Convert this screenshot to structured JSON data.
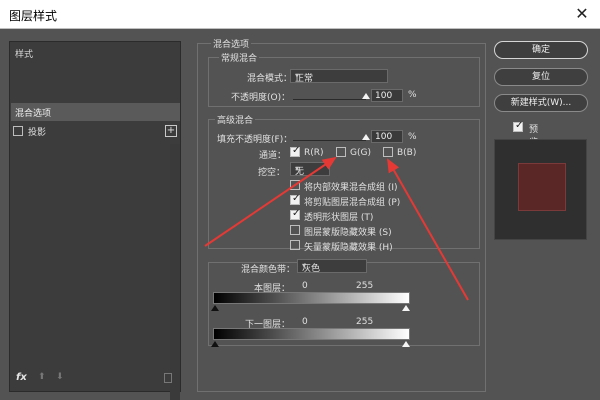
{
  "dialog": {
    "title": "图层样式",
    "close_symbol": "✕"
  },
  "left": {
    "header": "样式",
    "selected_item": "混合选项",
    "items": [
      {
        "label": "投影",
        "checked": false
      }
    ],
    "add_symbol": "+",
    "footer": {
      "fx": "fx",
      "up": "⬆",
      "down": "⬇"
    }
  },
  "blend": {
    "section_title": "混合选项",
    "general": {
      "title": "常规混合",
      "mode_label": "混合模式：",
      "mode_value": "正常",
      "opacity_label": "不透明度(O)：",
      "opacity_value": "100",
      "opacity_unit": "%",
      "opacity_level": 100
    },
    "advanced": {
      "title": "高级混合",
      "fill_label": "填充不透明度(F)：",
      "fill_value": "100",
      "fill_unit": "%",
      "fill_level": 100,
      "channels_label": "通道：",
      "channels": [
        {
          "label": "R(R)",
          "checked": true
        },
        {
          "label": "G(G)",
          "checked": false
        },
        {
          "label": "B(B)",
          "checked": false
        }
      ],
      "knockout_label": "挖空：",
      "knockout_value": "无",
      "options": [
        {
          "label": "将内部效果混合成组 (I)",
          "checked": false
        },
        {
          "label": "将剪贴图层混合成组 (P)",
          "checked": true
        },
        {
          "label": "透明形状图层 (T)",
          "checked": true
        },
        {
          "label": "图层蒙版隐藏效果 (S)",
          "checked": false
        },
        {
          "label": "矢量蒙版隐藏效果 (H)",
          "checked": false
        }
      ]
    },
    "blend_if": {
      "label": "混合颜色带：",
      "value": "灰色",
      "this_layer_label": "本图层：",
      "this_layer_min": "0",
      "this_layer_max": "255",
      "underlying_label": "下一图层：",
      "underlying_min": "0",
      "underlying_max": "255"
    }
  },
  "buttons": {
    "ok": "确定",
    "reset": "复位",
    "new_style": "新建样式(W)...",
    "preview_label": "预览(V)",
    "preview_checked": true
  },
  "colors": {
    "accent_arrow": "#e53935",
    "preview_swatch": "#5b2626"
  }
}
